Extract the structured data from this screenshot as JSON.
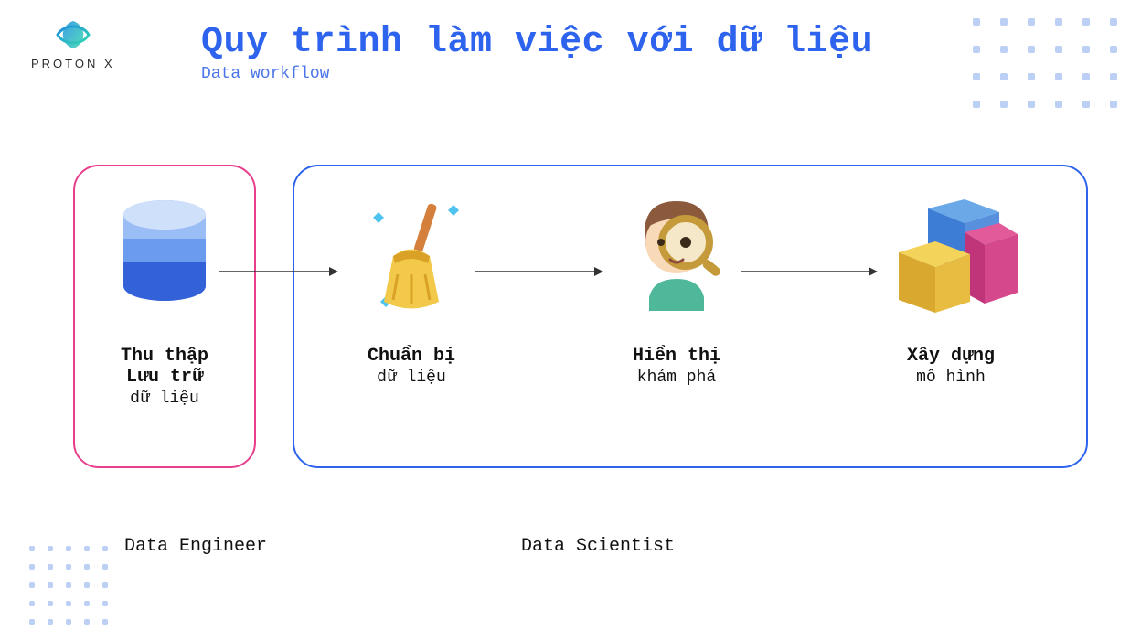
{
  "brand": {
    "name": "PROTON X"
  },
  "header": {
    "title": "Quy trình làm việc với dữ liệu",
    "subtitle": "Data workflow"
  },
  "steps": [
    {
      "title": "Thu thập\nLưu trữ",
      "subtitle": "dữ liệu",
      "icon": "database"
    },
    {
      "title": "Chuẩn bị",
      "subtitle": "dữ liệu",
      "icon": "broom"
    },
    {
      "title": "Hiển  thị",
      "subtitle": "khám phá",
      "icon": "magnifier-person"
    },
    {
      "title": "Xây dựng",
      "subtitle": "mô hình",
      "icon": "blocks"
    }
  ],
  "roles": {
    "engineer": "Data Engineer",
    "scientist": "Data Scientist"
  }
}
